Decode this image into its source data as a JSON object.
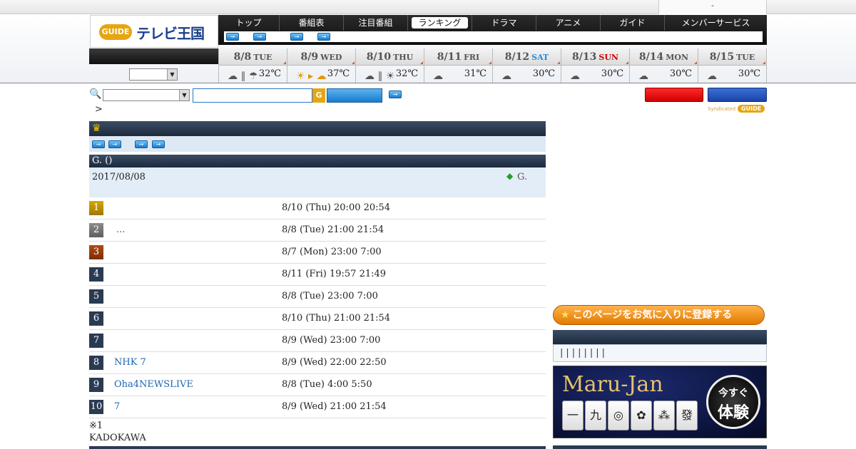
{
  "topbar": {
    "util_text": "-"
  },
  "logo": {
    "g_text": "GUIDE",
    "title": "テレビ王国"
  },
  "nav": {
    "tabs": [
      "トップ",
      "番組表",
      "注目番組",
      "ランキング",
      "ドラマ",
      "アニメ",
      "ガイド",
      "メンバーサービス"
    ],
    "active_index": 3
  },
  "weather": {
    "days": [
      {
        "date": "8/8",
        "weekday": "TUE",
        "icons": "☁ ∥ ☂",
        "temp": "32℃",
        "weekday_color": "#555555"
      },
      {
        "date": "8/9",
        "weekday": "WED",
        "icons": "☀ ▸ ☁",
        "temp": "37℃",
        "weekday_color": "#555555"
      },
      {
        "date": "8/10",
        "weekday": "THU",
        "icons": "☁ ∥ ☀",
        "temp": "32℃",
        "weekday_color": "#555555"
      },
      {
        "date": "8/11",
        "weekday": "FRI",
        "icons": "☁",
        "temp": "31℃",
        "weekday_color": "#555555"
      },
      {
        "date": "8/12",
        "weekday": "SAT",
        "icons": "☁",
        "temp": "30℃",
        "weekday_color": "#2a8ad6"
      },
      {
        "date": "8/13",
        "weekday": "SUN",
        "icons": "☁",
        "temp": "30℃",
        "weekday_color": "#cc0000"
      },
      {
        "date": "8/14",
        "weekday": "MON",
        "icons": "☁",
        "temp": "30℃",
        "weekday_color": "#555555"
      },
      {
        "date": "8/15",
        "weekday": "TUE",
        "icons": "☁",
        "temp": "30℃",
        "weekday_color": "#555555"
      }
    ]
  },
  "search": {
    "g_text": "G",
    "breadcrumb": ">"
  },
  "syndicated": {
    "label": "Syndicated",
    "g_text": "GUIDE"
  },
  "ranking": {
    "section_title": "G. ()",
    "date": "2017/08/08",
    "note_label": "G.",
    "rows": [
      {
        "rank": "1",
        "title": "",
        "time": "8/10 (Thu) 20:00  20:54"
      },
      {
        "rank": "2",
        "title": "...",
        "time": "8/8 (Tue) 21:00  21:54"
      },
      {
        "rank": "3",
        "title": "",
        "time": "8/7 (Mon) 23:00  7:00"
      },
      {
        "rank": "4",
        "title": "",
        "time": "8/11 (Fri) 19:57  21:49"
      },
      {
        "rank": "5",
        "title": "",
        "time": "8/8 (Tue) 23:00  7:00"
      },
      {
        "rank": "6",
        "title": "",
        "time": "8/10 (Thu) 21:00  21:54"
      },
      {
        "rank": "7",
        "title": "",
        "time": "8/9 (Wed) 23:00  7:00"
      },
      {
        "rank": "8",
        "title": "NHK 7",
        "time": "8/9 (Wed) 22:00  22:50"
      },
      {
        "rank": "9",
        "title": "Oha4NEWSLIVE",
        "time": "8/8 (Tue) 4:00  5:50"
      },
      {
        "rank": "10",
        "title": "7",
        "time": "8/9 (Wed) 21:00  21:54"
      }
    ],
    "footnote": "※1",
    "credit": "KADOKAWA"
  },
  "sidebar": {
    "favorite_label": "このページをお気に入りに登録する",
    "links_text": "||||||||",
    "banner": {
      "title": "Maru-Jan",
      "tiles": [
        "一",
        "九",
        "◎",
        "✿",
        "⁂",
        "發"
      ],
      "cta_line1": "今すぐ",
      "cta_line2": "体験"
    }
  }
}
